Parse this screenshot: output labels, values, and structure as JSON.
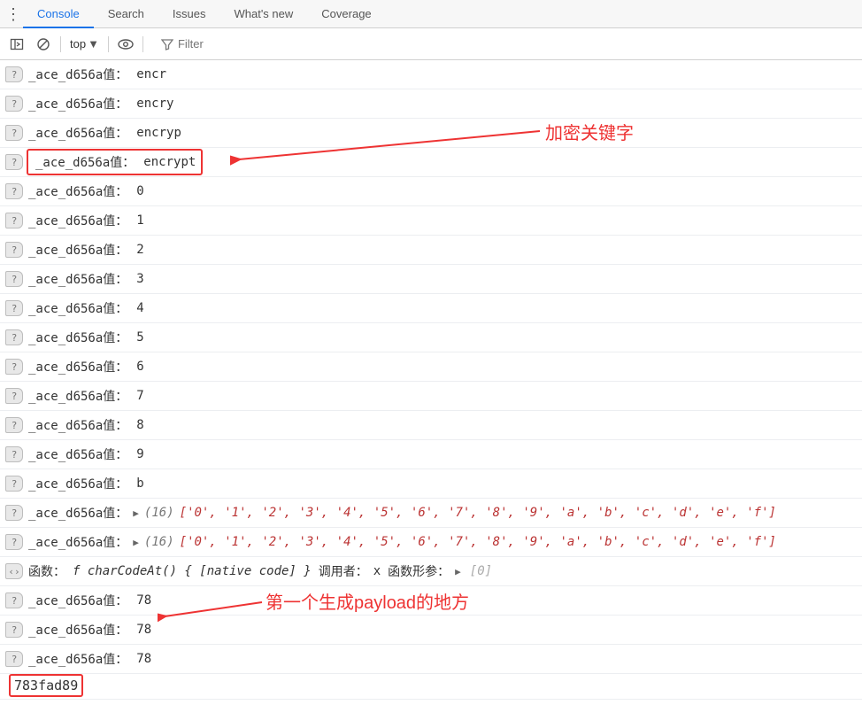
{
  "tabs": {
    "console": "Console",
    "search": "Search",
    "issues": "Issues",
    "whatsnew": "What's new",
    "coverage": "Coverage",
    "active": "console"
  },
  "toolbar": {
    "context": "top",
    "filter_placeholder": "Filter"
  },
  "label_prefix": "_ace_d656a值：",
  "rows": [
    {
      "k": "simple",
      "v": "encr"
    },
    {
      "k": "simple",
      "v": "encry"
    },
    {
      "k": "simple",
      "v": "encryp"
    },
    {
      "k": "simple",
      "v": "encrypt",
      "box": true
    },
    {
      "k": "simple",
      "v": "0"
    },
    {
      "k": "simple",
      "v": "1"
    },
    {
      "k": "simple",
      "v": "2"
    },
    {
      "k": "simple",
      "v": "3"
    },
    {
      "k": "simple",
      "v": "4"
    },
    {
      "k": "simple",
      "v": "5"
    },
    {
      "k": "simple",
      "v": "6"
    },
    {
      "k": "simple",
      "v": "7"
    },
    {
      "k": "simple",
      "v": "8"
    },
    {
      "k": "simple",
      "v": "9"
    },
    {
      "k": "simple",
      "v": "b"
    },
    {
      "k": "arr",
      "len": 16,
      "items": [
        "'0'",
        "'1'",
        "'2'",
        "'3'",
        "'4'",
        "'5'",
        "'6'",
        "'7'",
        "'8'",
        "'9'",
        "'a'",
        "'b'",
        "'c'",
        "'d'",
        "'e'",
        "'f'"
      ]
    },
    {
      "k": "arr",
      "len": 16,
      "items": [
        "'0'",
        "'1'",
        "'2'",
        "'3'",
        "'4'",
        "'5'",
        "'6'",
        "'7'",
        "'8'",
        "'9'",
        "'a'",
        "'b'",
        "'c'",
        "'d'",
        "'e'",
        "'f'"
      ]
    },
    {
      "k": "fn",
      "pre": "函数：",
      "sig": "f charCodeAt() { [native code] }",
      "caller_label": "调用者：",
      "caller": "x",
      "args_label": "函数形参：",
      "args": "[0]"
    },
    {
      "k": "simple",
      "v": "78"
    },
    {
      "k": "simple",
      "v": "78"
    },
    {
      "k": "simple",
      "v": "78"
    }
  ],
  "hash": "783fad89",
  "annotations": {
    "encrypt_keyword": "加密关键字",
    "first_payload": "第一个生成payload的地方"
  }
}
